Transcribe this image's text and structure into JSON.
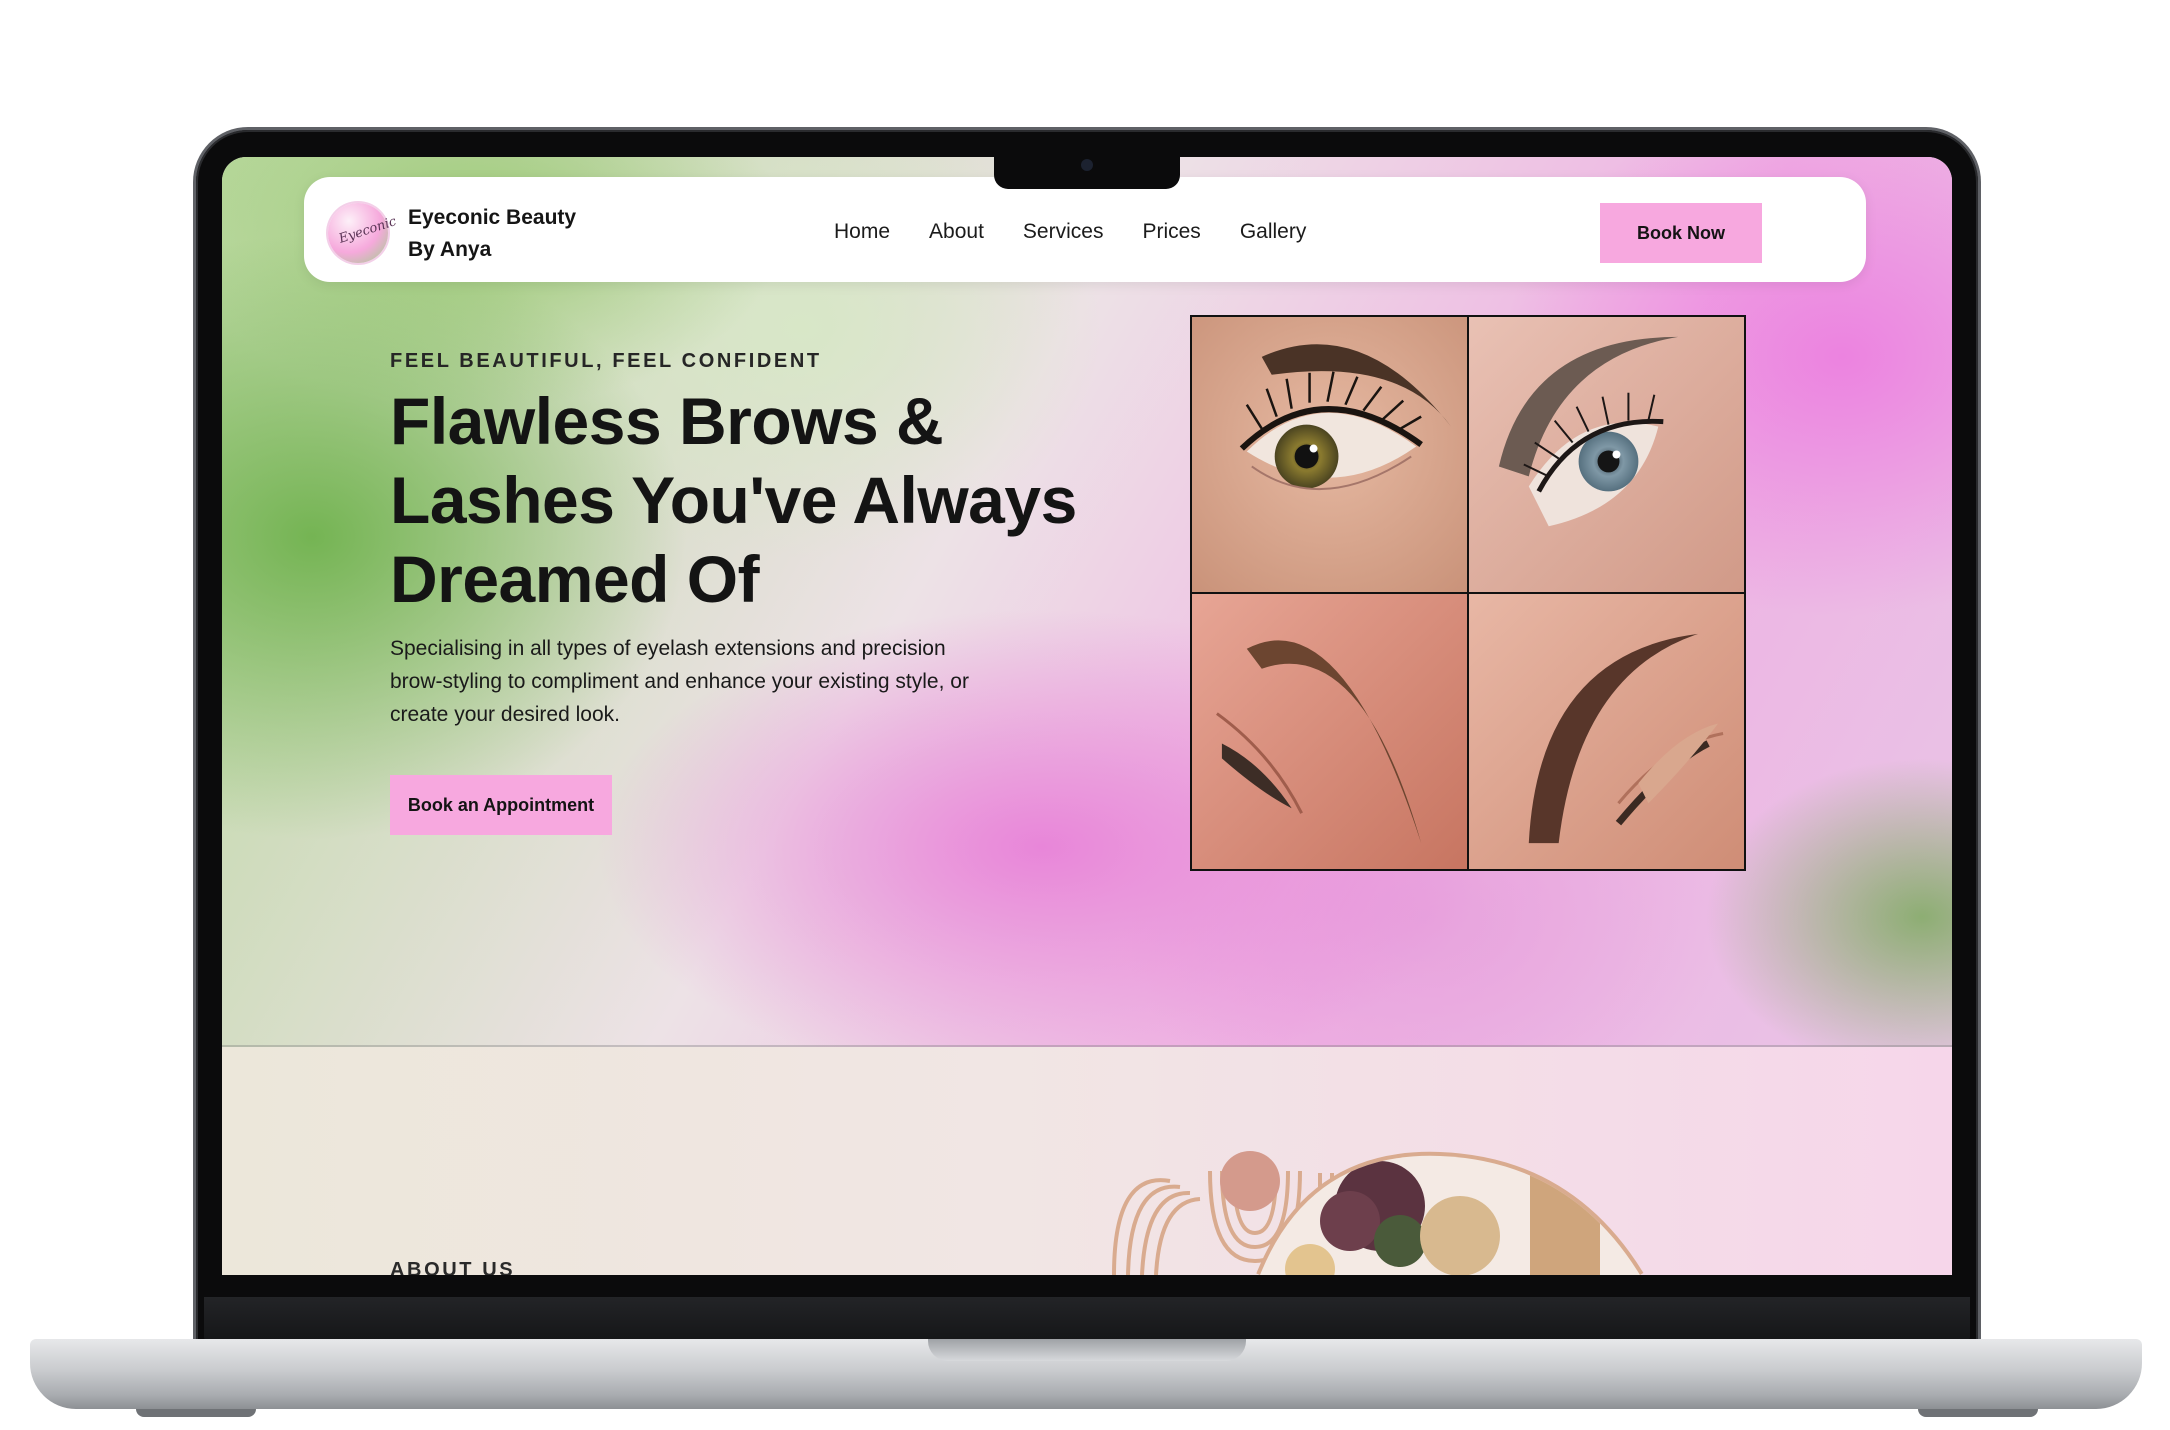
{
  "brand": {
    "name_line1": "Eyeconic Beauty",
    "name_line2": "By Anya"
  },
  "nav": {
    "items": [
      {
        "label": "Home"
      },
      {
        "label": "About"
      },
      {
        "label": "Services"
      },
      {
        "label": "Prices"
      },
      {
        "label": "Gallery"
      }
    ],
    "book_label": "Book Now"
  },
  "hero": {
    "eyebrow": "FEEL BEAUTIFUL, FEEL CONFIDENT",
    "headline": "Flawless Brows & Lashes You've Always Dreamed Of",
    "description": "Specialising in all types of eyelash extensions and precision brow-styling to compliment and enhance your existing style, or create your desired look.",
    "cta_label": "Book an Appointment"
  },
  "gallery": {
    "tiles": [
      "eye-lashes-photo",
      "brow-lashes-photo",
      "brow-closeup-photo",
      "brow-shaped-photo"
    ]
  },
  "about": {
    "label": "ABOUT US"
  },
  "colors": {
    "accent_pink": "#f7a8df",
    "text_dark": "#141414"
  }
}
